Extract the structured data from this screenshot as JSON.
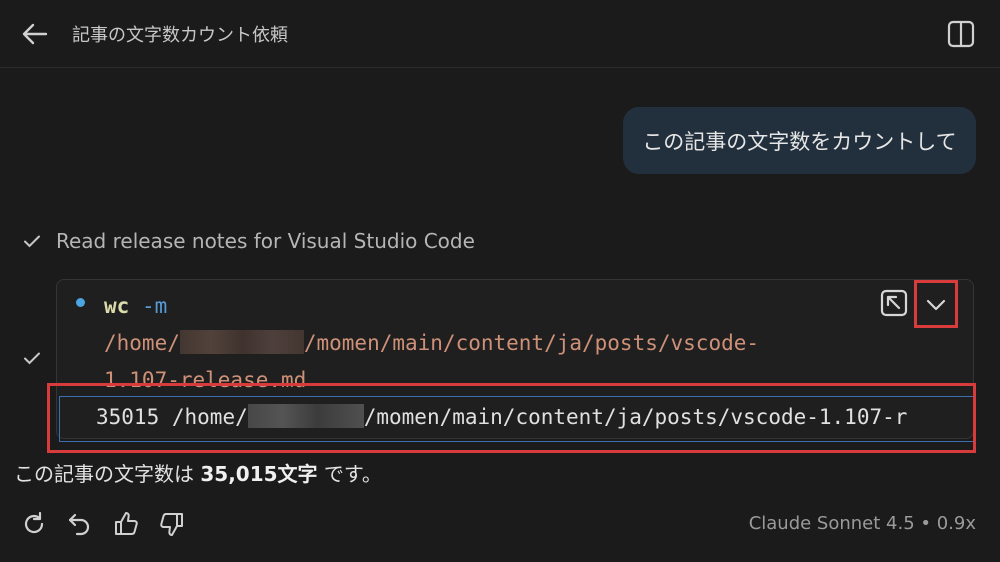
{
  "header": {
    "title": "記事の文字数カウント依頼"
  },
  "user_message": "この記事の文字数をカウントして",
  "tool_step": {
    "label": "Read release notes for Visual Studio Code"
  },
  "terminal": {
    "command_name": "wc",
    "command_flag": "-m",
    "path_prefix": "/home/",
    "path_suffix_line1": "/momen/main/content/ja/posts/vscode-",
    "path_line2": "1.107-release.md",
    "output_count": "35015",
    "output_path_prefix": "/home/",
    "output_path_suffix": "/momen/main/content/ja/posts/vscode-1.107-r"
  },
  "answer": {
    "prefix": "この記事の文字数は ",
    "count": "35,015文字",
    "suffix": " です。"
  },
  "footer": {
    "model": "Claude Sonnet 4.5 • 0.9x"
  },
  "colors": {
    "background": "#1b1b1c",
    "user_bubble": "#22303d",
    "highlight_border": "#d83b3b",
    "path_text": "#ce9178",
    "command_text": "#dcdcaa",
    "flag_text": "#569cd6"
  }
}
